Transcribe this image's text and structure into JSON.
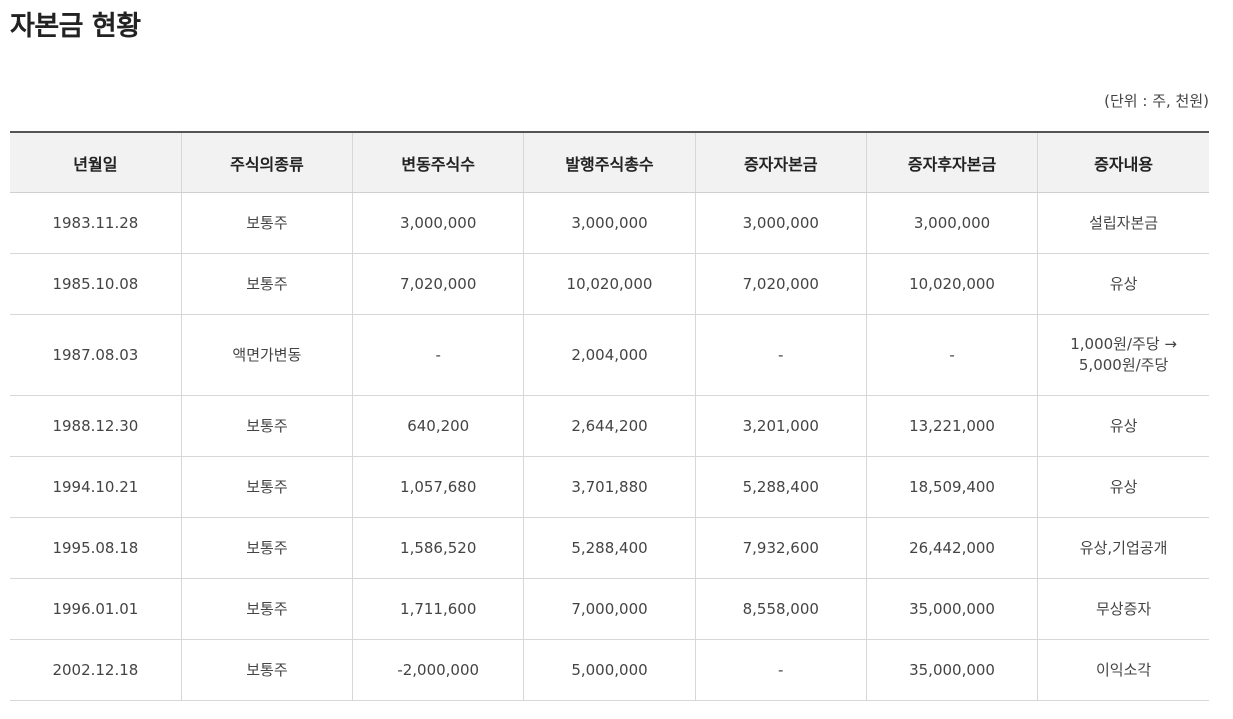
{
  "page": {
    "title": "자본금 현황",
    "unit": "(단위 : 주, 천원)"
  },
  "table": {
    "headers": [
      "년월일",
      "주식의종류",
      "변동주식수",
      "발행주식총수",
      "증자자본금",
      "증자후자본금",
      "증자내용"
    ],
    "rows": [
      [
        "1983.11.28",
        "보통주",
        "3,000,000",
        "3,000,000",
        "3,000,000",
        "3,000,000",
        "설립자본금"
      ],
      [
        "1985.10.08",
        "보통주",
        "7,020,000",
        "10,020,000",
        "7,020,000",
        "10,020,000",
        "유상"
      ],
      [
        "1987.08.03",
        "액면가변동",
        "-",
        "2,004,000",
        "-",
        "-",
        "1,000원/주당 →\n5,000원/주당"
      ],
      [
        "1988.12.30",
        "보통주",
        "640,200",
        "2,644,200",
        "3,201,000",
        "13,221,000",
        "유상"
      ],
      [
        "1994.10.21",
        "보통주",
        "1,057,680",
        "3,701,880",
        "5,288,400",
        "18,509,400",
        "유상"
      ],
      [
        "1995.08.18",
        "보통주",
        "1,586,520",
        "5,288,400",
        "7,932,600",
        "26,442,000",
        "유상,기업공개"
      ],
      [
        "1996.01.01",
        "보통주",
        "1,711,600",
        "7,000,000",
        "8,558,000",
        "35,000,000",
        "무상증자"
      ],
      [
        "2002.12.18",
        "보통주",
        "-2,000,000",
        "5,000,000",
        "-",
        "35,000,000",
        "이익소각"
      ]
    ]
  }
}
